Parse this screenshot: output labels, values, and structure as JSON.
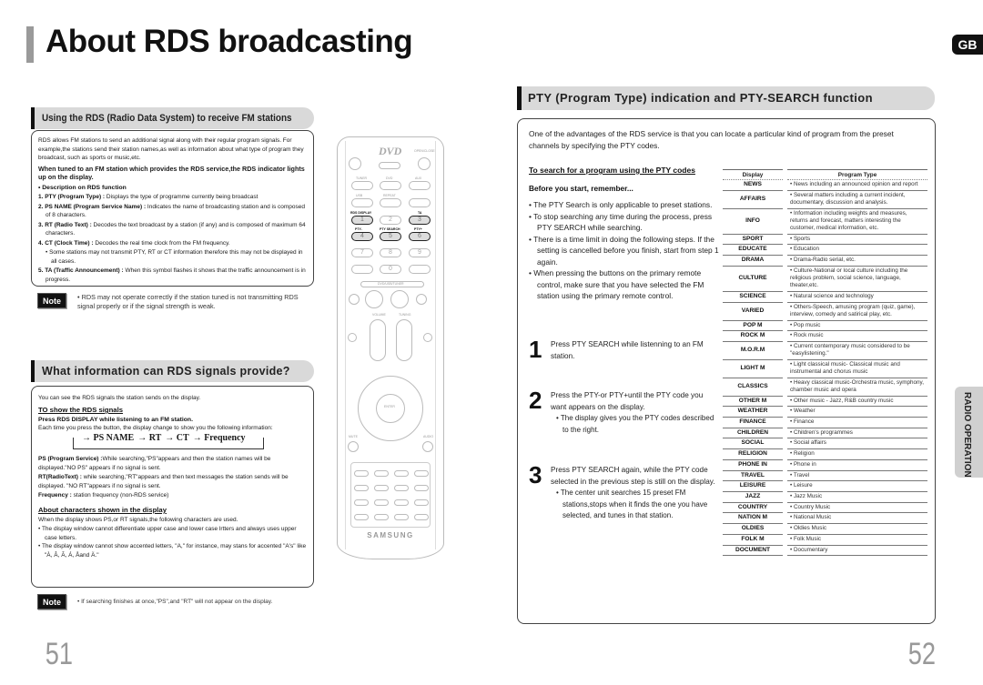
{
  "page_title": "About RDS broadcasting",
  "language_badge": "GB",
  "side_tab": "RADIO OPERATION",
  "page_numbers": {
    "left": "51",
    "right": "52"
  },
  "left": {
    "section1": {
      "heading": "Using the RDS (Radio Data System) to receive FM stations",
      "intro": "RDS allows FM stations to send an additional signal along with their regular program signals. For example,the stations send their station names,as well as information about what  type of program they broadcast, such as sports or music,etc.",
      "lead": "When tuned to an FM station which provides the RDS service,the RDS indicator lights up on the display.",
      "desc_heading": "• Description on RDS function",
      "items": [
        {
          "term": "1. PTY (Program Type) :",
          "text": " Displays the type of programme currently being broadcast"
        },
        {
          "term": "2. PS NAME (Program Service Name) :",
          "text": " Indicates the name of broadcasting station and is composed of 8 characters."
        },
        {
          "term": "3. RT (Radio Text) :",
          "text": " Decodes the text broadcast by a station (if any) and is composed of maximum 64 characters."
        },
        {
          "term": "4. CT (Clock Time) :",
          "text": " Decodes the real time clock from the FM frequency."
        },
        {
          "term": "",
          "text": "• Some stations may not transmit PTY, RT or CT information therefore this may not be displayed in all cases."
        },
        {
          "term": "5. TA (Traffic Announcement) :",
          "text": " When this symbol flashes it shows that the traffic announcement is in progress."
        }
      ],
      "note_label": "Note",
      "note_text": "• RDS may not operate correctly if the station tuned is not transmitting RDS signal properly or if the signal strength is weak."
    },
    "section2": {
      "heading": "What information can RDS signals provide?",
      "intro": "You can see the RDS signals the station sends on the display.",
      "show_heading": "TO show the RDS signals",
      "press_text": "Press RDS DISPLAY while listening to an FM station.",
      "each_time": "Each time you press the button, the display change to show you the following information:",
      "flow": [
        "PS NAME",
        "RT",
        "CT",
        "Frequency"
      ],
      "defs": [
        {
          "term": "PS (Program Service) :",
          "text": "While searching,\"PS\"appears and then the station names will be displayed.\"NO PS\" appears if no signal is sent."
        },
        {
          "term": "RT(RadioText) :",
          "text": " while searching,\"RT\"appears and then text messages the station sends will be displayed. \"NO RT\"appears if no signal is sent."
        },
        {
          "term": "Frequency :",
          "text": " station frequency (non-RDS service)"
        }
      ],
      "chars_heading": "About characters shown in the display",
      "chars_intro": "When the display shows PS,or RT signals,the following characters are used.",
      "chars_bullets": [
        "• The display window cannot differentiate upper case and lower case lrtters and always uses upper case letters.",
        "• The display window  cannot show accented letters, \"A,\" for instance, may stans for accented \"A's\" like \"À, Â, Ã, Á, Åand Ä.\""
      ],
      "note_label": "Note",
      "note_text": "• If searching finishes at once,\"PS\",and \"RT\" will not appear on the display."
    }
  },
  "remote": {
    "logo": "DVD",
    "brand": "SAMSUNG",
    "highlighted_labels": [
      "RDS DISPLAY",
      "TA",
      "PTY-",
      "PTY SEARCH",
      "PTY+"
    ],
    "highlighted_numbers": [
      "1",
      "3",
      "4",
      "5",
      "6"
    ],
    "other_numbers": [
      "2",
      "7",
      "8",
      "9",
      "0"
    ],
    "labels": [
      "OPEN/CLOSE",
      "TUNER",
      "DVD",
      "AUX",
      "USB",
      "REPEAT",
      "DVD/USB/TUNER",
      "VOLUME",
      "TUNING",
      "ENTER",
      "MUTE",
      "AUDIO"
    ]
  },
  "right": {
    "heading": "PTY (Program Type) indication and PTY-SEARCH function",
    "intro": "One  of the advantages of the RDS service is that you can locate a particular kind of program from the preset channels by specifying the PTY codes.",
    "search_heading": "To search for a program using the PTY codes",
    "before": "Before you start, remember...",
    "bullets": [
      "• The PTY Search is only applicable to preset stations.",
      "• To stop searching any time during the process, press PTY SEARCH while searching.",
      "• There is a time limit in doing the following steps. If the setting is cancelled before you finish, start from step 1 again.",
      "• When pressing the buttons on the primary remote control, make sure that you have selected the FM station using the primary remote control."
    ],
    "steps": [
      {
        "num": "1",
        "text": "Press PTY SEARCH while listenning to an FM station.",
        "sub": ""
      },
      {
        "num": "2",
        "text": "Press the PTY-or PTY+until the PTY code you want appears on the display.",
        "sub": "• The display gives you the PTY codes described to the right."
      },
      {
        "num": "3",
        "text": "Press PTY SEARCH again, while the PTY code selected in the previous step is still on the display.",
        "sub": "• The center unit searches 15 preset FM stations,stops when it finds the one you have selected, and tunes in that station."
      }
    ],
    "table": {
      "headers": [
        "Display",
        "Program Type"
      ],
      "rows": [
        [
          "NEWS",
          "• News including an announced opinion and report"
        ],
        [
          "AFFAIRS",
          "• Several matters including a current incident, documentary, discussion and analysis."
        ],
        [
          "INFO",
          "•  Information including weights and measures, returns and forecast, matters interesting the customer, medical information, etc."
        ],
        [
          "SPORT",
          "• Sports"
        ],
        [
          "EDUCATE",
          "• Education"
        ],
        [
          "DRAMA",
          "• Drama-Radio serial, etc."
        ],
        [
          "CULTURE",
          "• Culture-National or local culture including the religious problem, social science, language, theater,etc."
        ],
        [
          "SCIENCE",
          "• Natural science and technology"
        ],
        [
          "VARIED",
          "• Others-Speech, amusing program (quiz, game), interview, comedy and satirical play, etc."
        ],
        [
          "POP M",
          "• Pop music"
        ],
        [
          "ROCK M",
          "• Rock music"
        ],
        [
          "M.O.R.M",
          "• Current contemporary music considered to be \"easylistening.\""
        ],
        [
          "LIGHT M",
          "• Light classical music- Classical music and instrumental and chorus music"
        ],
        [
          "CLASSICS",
          "• Heavy classical  music-Orchestra music, symphony, chamber music and opera"
        ],
        [
          "OTHER M",
          "• Other music - Jazz, R&B country music"
        ],
        [
          "WEATHER",
          "• Weather"
        ],
        [
          "FINANCE",
          "• Finance"
        ],
        [
          "CHILDREN",
          "• Children's programmes"
        ],
        [
          "SOCIAL",
          "• Social affairs"
        ],
        [
          "RELIGION",
          "• Religion"
        ],
        [
          "PHONE IN",
          "• Phone in"
        ],
        [
          "TRAVEL",
          "• Travel"
        ],
        [
          "LEISURE",
          "• Leisure"
        ],
        [
          "JAZZ",
          "• Jazz Music"
        ],
        [
          "COUNTRY",
          "• Country Music"
        ],
        [
          "NATION M",
          "• National Music"
        ],
        [
          "OLDIES",
          "• Oldies Music"
        ],
        [
          "FOLK M",
          "• Folk Music"
        ],
        [
          "DOCUMENT",
          "• Documentary"
        ]
      ]
    }
  }
}
